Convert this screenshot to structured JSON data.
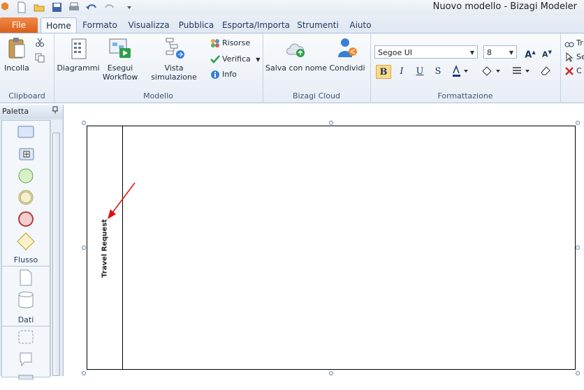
{
  "window": {
    "title": "Nuovo modello - Bizagi Modeler"
  },
  "tabs": {
    "file": "File",
    "home": "Home",
    "formato": "Formato",
    "visualizza": "Visualizza",
    "pubblica": "Pubblica",
    "esporta": "Esporta/Importa",
    "strumenti": "Strumenti",
    "aiuto": "Aiuto"
  },
  "ribbon": {
    "clipboard": {
      "label": "Clipboard",
      "paste": "Incolla"
    },
    "modello": {
      "label": "Modello",
      "diagrammi": "Diagrammi",
      "esegui_line1": "Esegui",
      "esegui_line2": "Workflow",
      "vista": "Vista simulazione",
      "risorse": "Risorse",
      "verifica": "Verifica",
      "info": "Info"
    },
    "cloud": {
      "label": "Bizagi Cloud",
      "salva": "Salva con nome",
      "condividi": "Condividi"
    },
    "formattazione": {
      "label": "Formattazione",
      "font": "Segoe UI",
      "size": "8",
      "bold": "B",
      "italic": "I",
      "underline": "U",
      "strike": "S"
    },
    "partial": {
      "item1": "Tr",
      "item2": "Se",
      "item3": "C"
    }
  },
  "palette": {
    "title": "Paletta",
    "flusso": "Flusso",
    "dati": "Dati"
  },
  "diagram": {
    "pool_name": "Travel Request"
  }
}
